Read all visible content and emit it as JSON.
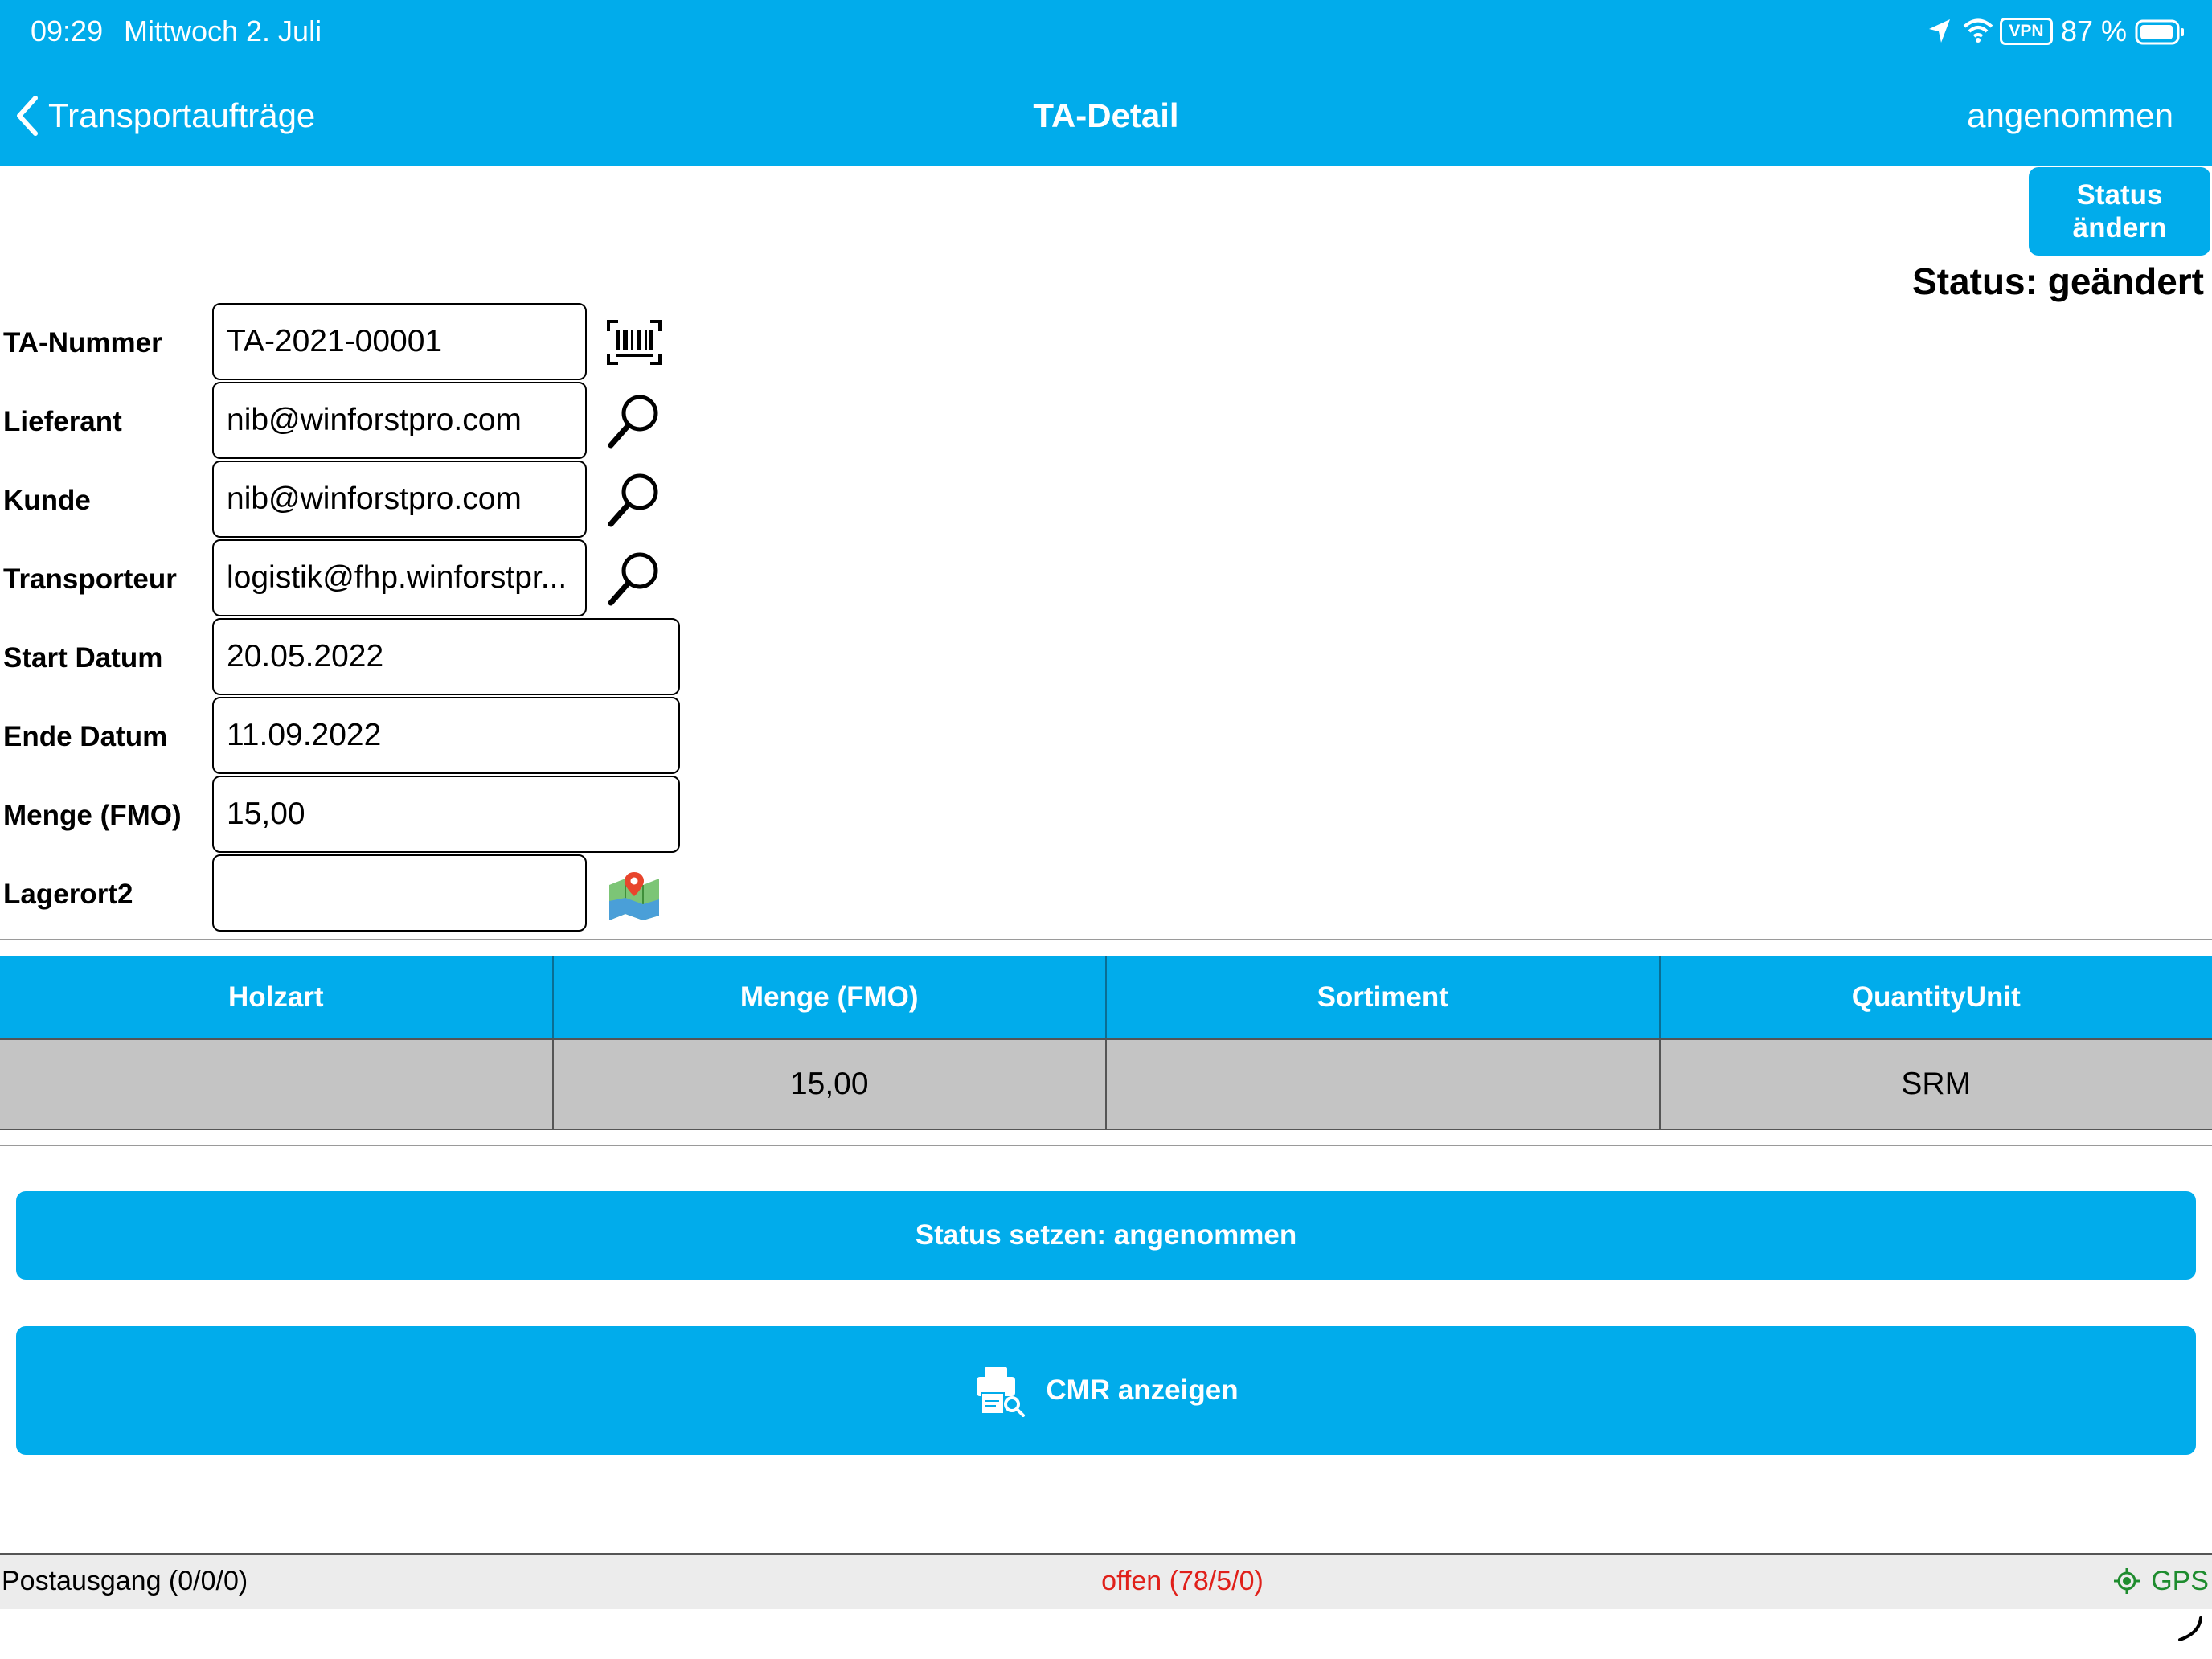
{
  "status_bar": {
    "time": "09:29",
    "date": "Mittwoch 2. Juli",
    "vpn": "VPN",
    "battery": "87 %"
  },
  "nav": {
    "back_label": "Transportaufträge",
    "title": "TA-Detail",
    "right_label": "angenommen"
  },
  "status": {
    "button_line1": "Status",
    "button_line2": "ändern",
    "label": "Status: geändert"
  },
  "form": {
    "ta_nummer": {
      "label": "TA-Nummer",
      "value": "TA-2021-00001"
    },
    "lieferant": {
      "label": "Lieferant",
      "value": "nib@winforstpro.com"
    },
    "kunde": {
      "label": "Kunde",
      "value": "nib@winforstpro.com"
    },
    "transporteur": {
      "label": "Transporteur",
      "value": "logistik@fhp.winforstpr..."
    },
    "start_datum": {
      "label": "Start Datum",
      "value": "20.05.2022"
    },
    "ende_datum": {
      "label": "Ende Datum",
      "value": "11.09.2022"
    },
    "menge": {
      "label": "Menge (FMO)",
      "value": "15,00"
    },
    "lagerort": {
      "label": "Lagerort2",
      "value": ""
    }
  },
  "table": {
    "headers": [
      "Holzart",
      "Menge (FMO)",
      "Sortiment",
      "QuantityUnit"
    ],
    "rows": [
      [
        "",
        "15,00",
        "",
        "SRM"
      ]
    ]
  },
  "buttons": {
    "set_status": "Status setzen: angenommen",
    "cmr": "CMR anzeigen"
  },
  "footer": {
    "outbox": "Postausgang (0/0/0)",
    "open": "offen (78/5/0)",
    "gps": "GPS"
  },
  "colors": {
    "accent": "#01aceb",
    "open_red": "#e0201a",
    "gps_green": "#1e8c2e"
  },
  "icons": {
    "barcode": "barcode-scan-icon",
    "search": "magnifier-icon",
    "map": "map-pin-icon",
    "printer": "printer-search-icon",
    "gps": "gps-target-icon"
  }
}
